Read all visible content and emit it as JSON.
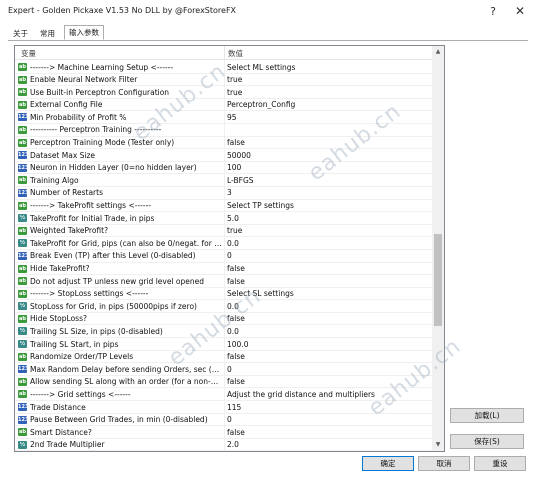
{
  "window": {
    "title": "Expert - Golden Pickaxe V1.53 No DLL by @ForexStoreFX",
    "help_glyph": "?",
    "close_glyph": "✕"
  },
  "tabs": [
    {
      "label": "关于"
    },
    {
      "label": "常用"
    },
    {
      "label": "输入参数"
    }
  ],
  "grid": {
    "col_variable": "变量",
    "col_value": "数值",
    "rows": [
      {
        "icon": "ab",
        "name": "-------> Machine Learning Setup <------",
        "value": "Select ML settings"
      },
      {
        "icon": "ab",
        "name": "Enable Neural Network Filter",
        "value": "true"
      },
      {
        "icon": "ab",
        "name": "Use Built-in Perceptron Configuration",
        "value": "true"
      },
      {
        "icon": "ab",
        "name": "External Config File",
        "value": "Perceptron_Config"
      },
      {
        "icon": "num",
        "name": "Min Probability of Profit %",
        "value": "95"
      },
      {
        "icon": "ab",
        "name": "---------- Perceptron Training ----------",
        "value": ""
      },
      {
        "icon": "ab",
        "name": "Perceptron Training Mode (Tester only)",
        "value": "false"
      },
      {
        "icon": "num",
        "name": "Dataset Max Size",
        "value": "50000"
      },
      {
        "icon": "num",
        "name": "Neuron in Hidden Layer (0=no hidden layer)",
        "value": "100"
      },
      {
        "icon": "ab",
        "name": "Training Algo",
        "value": "L-BFGS"
      },
      {
        "icon": "num",
        "name": "Number of Restarts",
        "value": "3"
      },
      {
        "icon": "ab",
        "name": "-------> TakeProfit settings <------",
        "value": "Select TP settings"
      },
      {
        "icon": "half",
        "name": "TakeProfit for Initial Trade, in pips",
        "value": "5.0"
      },
      {
        "icon": "ab",
        "name": "Weighted TakeProfit?",
        "value": "true"
      },
      {
        "icon": "half",
        "name": "TakeProfit for Grid, pips (can also be 0/negat. for em...",
        "value": "0.0"
      },
      {
        "icon": "num",
        "name": "Break Even (TP) after this Level (0-disabled)",
        "value": "0"
      },
      {
        "icon": "ab",
        "name": "Hide TakeProfit?",
        "value": "false"
      },
      {
        "icon": "ab",
        "name": "Do not adjust TP unless new grid level opened",
        "value": "false"
      },
      {
        "icon": "ab",
        "name": "-------> StopLoss settings <------",
        "value": "Select SL settings"
      },
      {
        "icon": "half",
        "name": "StopLoss for Grid, in pips (50000pips if zero)",
        "value": "0.0"
      },
      {
        "icon": "ab",
        "name": "Hide StopLoss?",
        "value": "false"
      },
      {
        "icon": "half",
        "name": "Trailing SL Size, in pips (0-disabled)",
        "value": "0.0"
      },
      {
        "icon": "half",
        "name": "Trailing SL Start, in pips",
        "value": "100.0"
      },
      {
        "icon": "ab",
        "name": "Randomize Order/TP Levels",
        "value": "false"
      },
      {
        "icon": "num",
        "name": "Max Random Delay before sending Orders, sec (0-disable...",
        "value": "0"
      },
      {
        "icon": "ab",
        "name": "Allow sending SL along with an order (for a non-ECN ...",
        "value": "false"
      },
      {
        "icon": "ab",
        "name": "-------> Grid settings <------",
        "value": "Adjust the grid distance and multipliers"
      },
      {
        "icon": "num",
        "name": "Trade Distance",
        "value": "115"
      },
      {
        "icon": "num",
        "name": "Pause Between Grid Trades, in min (0-disabled)",
        "value": "0"
      },
      {
        "icon": "ab",
        "name": "Smart Distance?",
        "value": "false"
      },
      {
        "icon": "half",
        "name": "2nd Trade Multiplier",
        "value": "2.0"
      }
    ]
  },
  "scrollbar": {
    "up_glyph": "▲",
    "down_glyph": "▼"
  },
  "buttons": {
    "load": "加载(L)",
    "save": "保存(S)",
    "ok": "确定",
    "cancel": "取消",
    "reset": "重设"
  },
  "watermark": "eahub.cn"
}
